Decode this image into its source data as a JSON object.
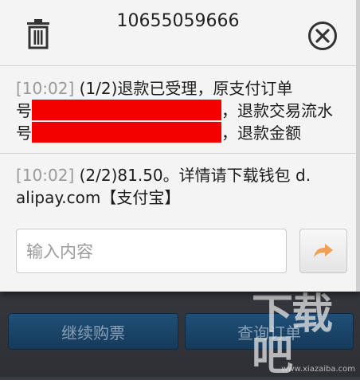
{
  "header": {
    "title": "10655059666"
  },
  "messages": [
    {
      "time": "[10:02]",
      "line1": " (1/2)退款已受理，原支付订单",
      "line2_prefix": "号",
      "line2_suffix": "，退款交易流水",
      "line3_prefix": "号",
      "line3_suffix": "，退款金额"
    },
    {
      "time": "[10:02]",
      "line1": " (2/2)81.50。详情请下载钱包 d.",
      "line2": "alipay.com【支付宝】"
    }
  ],
  "input": {
    "placeholder": "输入内容"
  },
  "background": {
    "left_button": "继续购票",
    "right_button": "查询订单"
  },
  "watermark": {
    "text": "下载吧",
    "sub": "www.xiazaiba.com"
  },
  "colors": {
    "accent": "#f0a050",
    "redaction": "#f20000",
    "timestamp": "#9a9a9a"
  },
  "icons": [
    "trash-icon",
    "close-icon",
    "send-arrow-icon"
  ]
}
